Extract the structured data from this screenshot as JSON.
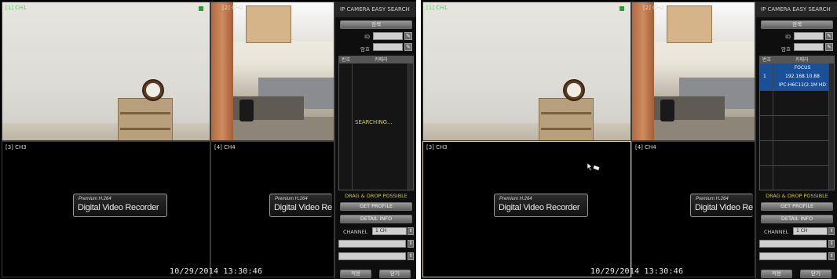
{
  "screens": [
    {
      "id": "left",
      "tiles": [
        {
          "label": "[1] CH1",
          "active": true
        },
        {
          "label": "[2] CH2",
          "active": false
        },
        {
          "label": "[3] CH3",
          "active": false
        },
        {
          "label": "[4] CH4",
          "active": false
        }
      ],
      "datetime": "10/29/2014 13:30:46",
      "panel": {
        "title": "IP CAMERA EASY SEARCH",
        "search_button": "검색",
        "id_label": "ID",
        "pw_label": "암호",
        "list_headers": [
          "번호",
          "카메라"
        ],
        "status_text": "SEARCHING...",
        "results": [],
        "drag_drop": "DRAG & DROP POSSIBLE",
        "get_profile": "GET PROFILE",
        "detail_info": "DETAIL INFO",
        "channel_label": "CHANNEL",
        "channel_value": "1 CH",
        "apply_button": "적용",
        "close_button": "닫기"
      }
    },
    {
      "id": "right",
      "tiles": [
        {
          "label": "[1] CH1",
          "active": true
        },
        {
          "label": "[2] CH2",
          "active": false
        },
        {
          "label": "[3] CH3",
          "active": false
        },
        {
          "label": "[4] CH4",
          "active": false
        }
      ],
      "datetime": "10/29/2014 13:30:46",
      "panel": {
        "title": "IP CAMERA EASY SEARCH",
        "search_button": "검색",
        "id_label": "ID",
        "pw_label": "암호",
        "list_headers": [
          "번호",
          "카메라"
        ],
        "status_text": "",
        "results": [
          {
            "num": "1",
            "name": "FOCUS",
            "ip": "192.168.10.88",
            "model": "IPC-H6C11(2.1M HD"
          }
        ],
        "drag_drop": "DRAG & DROP POSSIBLE",
        "get_profile": "GET PROFILE",
        "detail_info": "DETAIL INFO",
        "channel_label": "CHANNEL",
        "channel_value": "1 CH",
        "apply_button": "적용",
        "close_button": "닫기"
      }
    }
  ],
  "logo": {
    "small": "Premium H.264",
    "big": "Digital Video Recorder",
    "big_cropped": "Digital Video Re"
  },
  "colors": {
    "active_label": "#38e638",
    "status_yellow": "#d6d200",
    "selected_row": "#1a4f9a"
  }
}
